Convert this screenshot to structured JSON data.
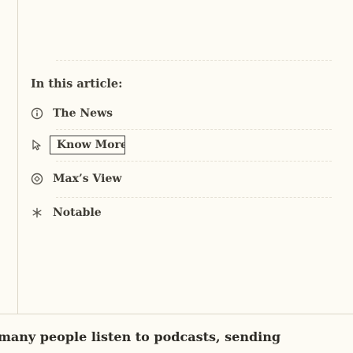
{
  "toc": {
    "title": "In this article:",
    "items": [
      {
        "label": "The News",
        "icon": "info-circle-icon"
      },
      {
        "label": "Know More",
        "icon": "cursor-icon",
        "active": true
      },
      {
        "label": "Max’s View",
        "icon": "compass-icon"
      },
      {
        "label": "Notable",
        "icon": "asterisk-icon"
      }
    ]
  },
  "article": {
    "text": "many people listen to podcasts, sending"
  },
  "colors": {
    "background": "#fdfbf4",
    "text": "#3f3c35",
    "border": "#dcd7c8"
  }
}
